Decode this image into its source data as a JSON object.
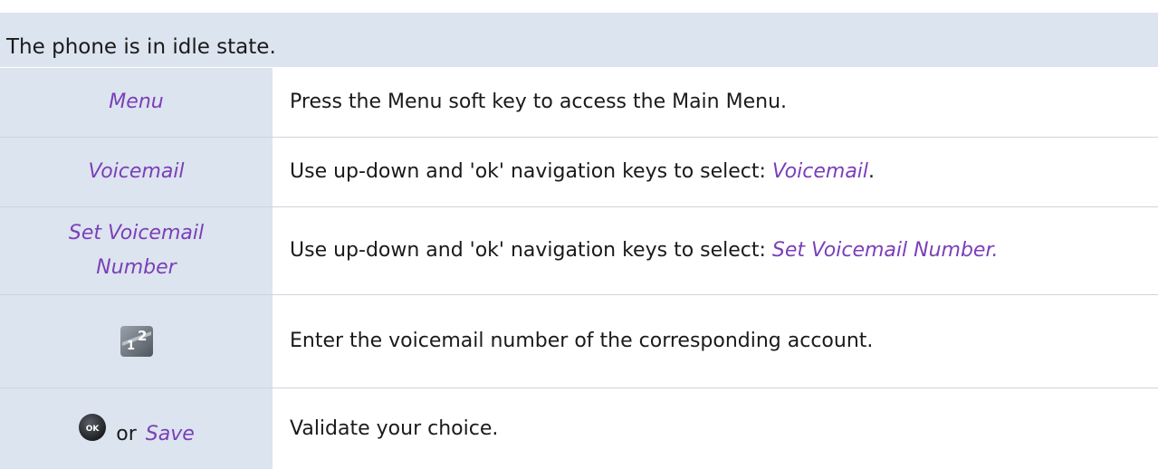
{
  "header": {
    "text": "The phone is in idle state."
  },
  "rows": [
    {
      "left": "Menu",
      "right": "Press the Menu soft key to access the Main Menu."
    },
    {
      "left": "Voicemail",
      "right_prefix": "Use up-down and 'ok' navigation keys to select: ",
      "right_keyword": "Voicemail",
      "right_suffix": "."
    },
    {
      "left": "Set Voicemail Number",
      "right_prefix": "Use up-down and 'ok' navigation keys to select: ",
      "right_keyword": "Set Voicemail Number.",
      "right_suffix": ""
    },
    {
      "left_icon": "numeric-keypad-icon",
      "keypad_digits": [
        "1",
        "2"
      ],
      "right": "Enter the voicemail number of the corresponding account."
    },
    {
      "left_icon": "ok-button-icon",
      "ok_label": "OK",
      "left_or": "or",
      "left_keyword": "Save",
      "right": "Validate your choice."
    }
  ],
  "colors": {
    "header_bg": "#dce4ef",
    "keyword": "#7b3fb8",
    "text": "#1a1a1a"
  }
}
